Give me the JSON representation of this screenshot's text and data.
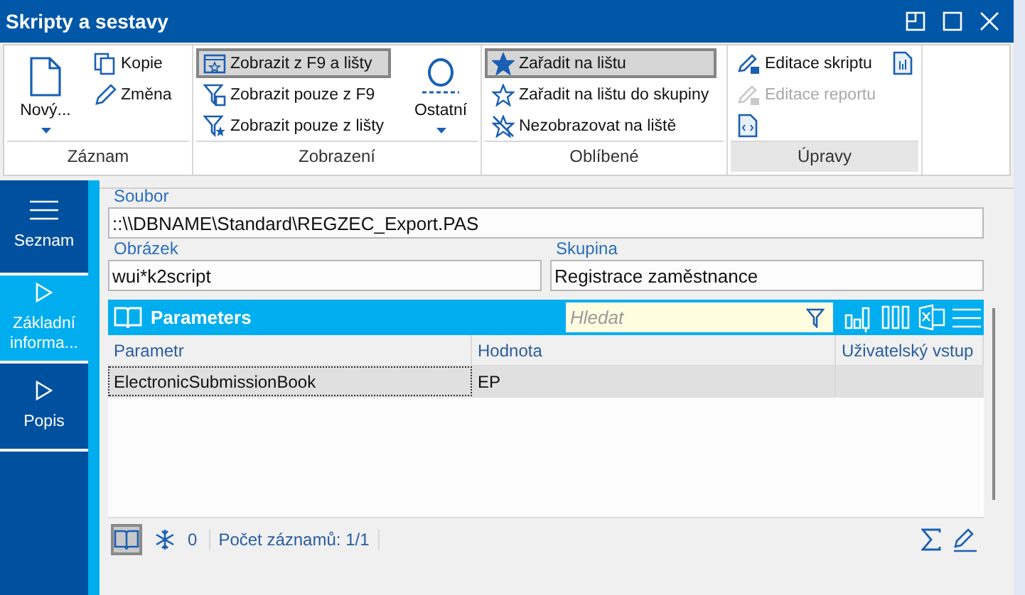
{
  "window": {
    "title": "Skripty a sestavy"
  },
  "ribbon": {
    "groups": [
      {
        "label": "Záznam",
        "highlighted": false,
        "items": [
          {
            "label": "Nový...",
            "kind": "large",
            "dropdown": true
          },
          {
            "label": "Kopie",
            "kind": "small"
          },
          {
            "label": "Změna",
            "kind": "small"
          }
        ]
      },
      {
        "label": "Zobrazení",
        "highlighted": false,
        "items": [
          {
            "label": "Zobrazit z F9 a lišty",
            "kind": "small",
            "selected": true
          },
          {
            "label": "Zobrazit pouze z F9",
            "kind": "small",
            "selected": false
          },
          {
            "label": "Zobrazit pouze z lišty",
            "kind": "small",
            "selected": false
          },
          {
            "label": "Ostatní",
            "kind": "large",
            "dropdown": true
          }
        ]
      },
      {
        "label": "Oblíbené",
        "highlighted": false,
        "items": [
          {
            "label": "Zařadit na lištu",
            "kind": "small",
            "selected": true
          },
          {
            "label": "Zařadit na lištu do skupiny",
            "kind": "small",
            "selected": false
          },
          {
            "label": "Nezobrazovat na liště",
            "kind": "small",
            "selected": false
          }
        ]
      },
      {
        "label": "Úpravy",
        "highlighted": true,
        "items": [
          {
            "label": "Editace skriptu",
            "kind": "small",
            "disabled": false
          },
          {
            "label": "Editace reportu",
            "kind": "small",
            "disabled": true
          },
          {
            "kind": "icon"
          },
          {
            "kind": "icon"
          }
        ]
      }
    ]
  },
  "sidebar": {
    "items": [
      {
        "label": "Seznam",
        "selected": false
      },
      {
        "label": "Základní informa...",
        "selected": true
      },
      {
        "label": "Popis",
        "selected": false
      }
    ]
  },
  "form": {
    "rows": [
      [
        {
          "label": "Soubor",
          "value": "::\\\\DBNAME\\Standard\\REGZEC_Export.PAS"
        }
      ],
      [
        {
          "label": "Obrázek",
          "value": "wui*k2script"
        },
        {
          "label": "Skupina",
          "value": "Registrace zaměstnance"
        }
      ]
    ]
  },
  "grid": {
    "title": "Parameters",
    "search": {
      "placeholder": "Hledat"
    },
    "columns": [
      "Parametr",
      "Hodnota",
      "Uživatelský vstup"
    ],
    "rows": [
      {
        "cells": [
          "ElectronicSubmissionBook",
          "EP"
        ],
        "selected": true
      }
    ],
    "footer": {
      "book_pressed": true,
      "count": "0",
      "records": "Počet záznamů: 1/1"
    }
  }
}
